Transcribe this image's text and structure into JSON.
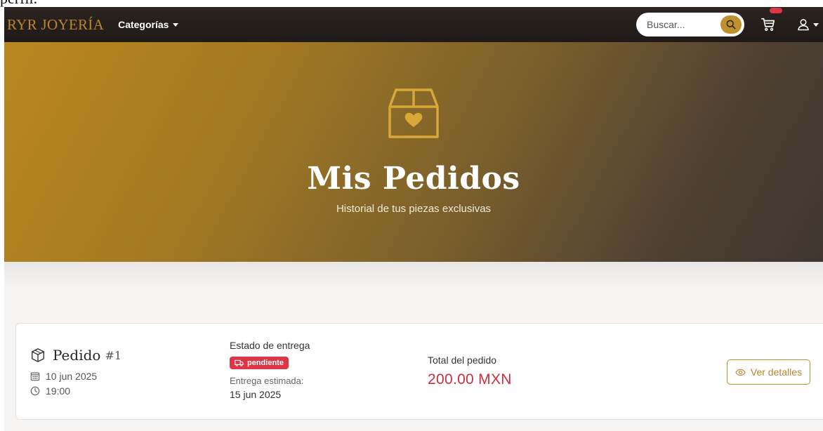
{
  "navbar": {
    "brand": "RYR JOYERÍA",
    "categories_label": "Categorías",
    "search_placeholder": "Buscar...",
    "icons": [
      "search-icon",
      "cart-icon",
      "user-icon",
      "chevron-down-icon"
    ]
  },
  "hero": {
    "title": "Mis Pedidos",
    "subtitle": "Historial de tus piezas exclusivas",
    "icon": "box-heart-icon"
  },
  "orders": [
    {
      "title": "Pedido",
      "number": "#1",
      "date": "10 jun 2025",
      "time": "19:00",
      "delivery_label": "Estado de entrega",
      "status": "pendiente",
      "estimated_label": "Entrega estimada:",
      "estimated_date": "15 jun 2025",
      "total_label": "Total del pedido",
      "total": "200.00 MXN",
      "details_label": "Ver detalles"
    }
  ],
  "colors": {
    "brand_gold": "#b8862b",
    "navbar_bg": "#1f1a18",
    "status_red": "#dc3545",
    "total_red": "#c8303d"
  }
}
